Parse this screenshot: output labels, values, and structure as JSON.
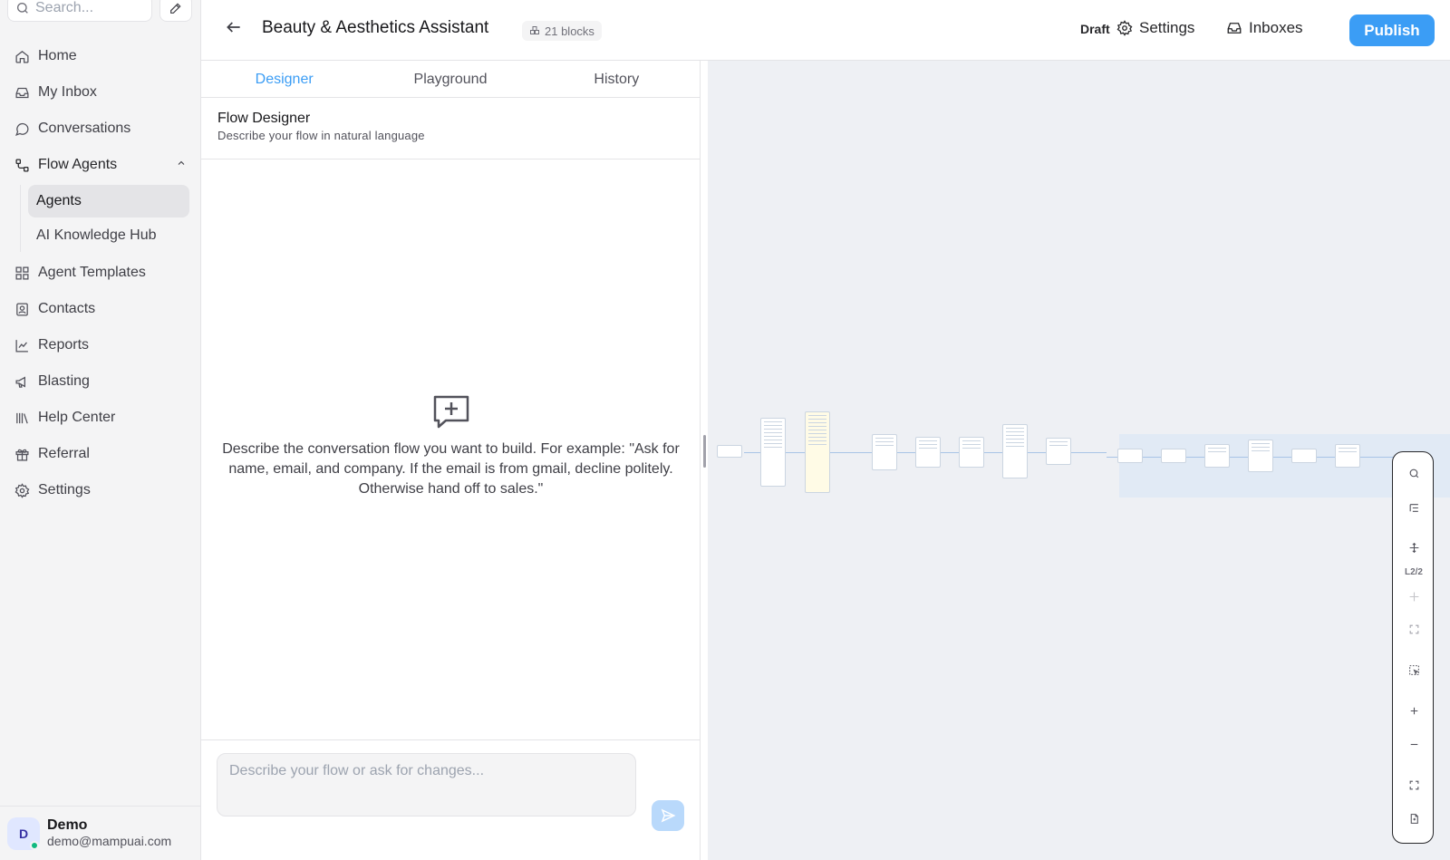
{
  "sidebar": {
    "search_placeholder": "Search...",
    "nav": [
      {
        "label": "Home",
        "icon": "home-icon"
      },
      {
        "label": "My Inbox",
        "icon": "inbox-icon"
      },
      {
        "label": "Conversations",
        "icon": "chat-icon"
      }
    ],
    "flow_agents": {
      "label": "Flow Agents",
      "icon": "flow-icon"
    },
    "subitems": [
      {
        "label": "Agents",
        "active": true
      },
      {
        "label": "AI Knowledge Hub",
        "active": false
      }
    ],
    "nav2": [
      {
        "label": "Agent Templates",
        "icon": "grid-icon"
      },
      {
        "label": "Contacts",
        "icon": "contacts-icon"
      },
      {
        "label": "Reports",
        "icon": "chart-icon"
      },
      {
        "label": "Blasting",
        "icon": "megaphone-icon"
      },
      {
        "label": "Help Center",
        "icon": "library-icon"
      },
      {
        "label": "Referral",
        "icon": "gift-icon"
      },
      {
        "label": "Settings",
        "icon": "gear-icon"
      }
    ],
    "user": {
      "initial": "D",
      "name": "Demo",
      "email": "demo@mampuai.com"
    }
  },
  "header": {
    "title": "Beauty & Aesthetics Assistant",
    "blocks": "21 blocks",
    "status": "Draft",
    "settings_label": "Settings",
    "inboxes_label": "Inboxes",
    "publish_label": "Publish"
  },
  "panel": {
    "tabs": [
      {
        "label": "Designer",
        "active": true
      },
      {
        "label": "Playground",
        "active": false
      },
      {
        "label": "History",
        "active": false
      }
    ],
    "section_title": "Flow Designer",
    "section_subtitle": "Describe your flow in natural language",
    "empty_text": "Describe the conversation flow you want to build. For example: \"Ask for name, email, and company. If the email is from gmail, decline politely. Otherwise hand off to sales.\"",
    "composer_placeholder": "Describe your flow or ask for changes..."
  },
  "canvas": {
    "zoom_label": "L2/2",
    "accent": "#3b9df5"
  }
}
